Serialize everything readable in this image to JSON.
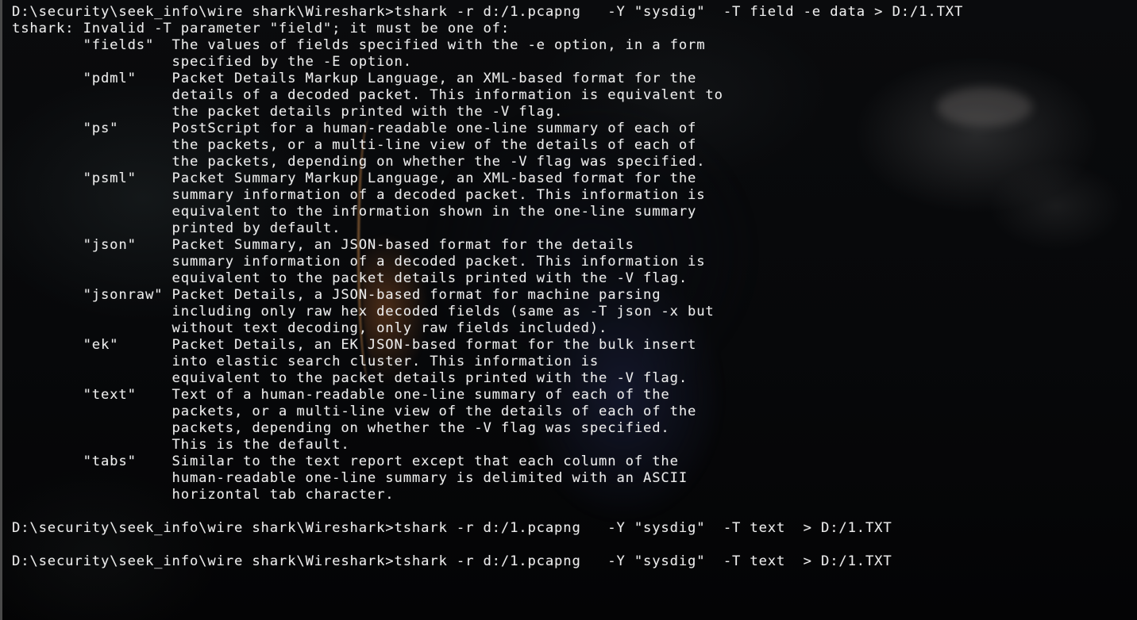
{
  "terminal": {
    "lines": [
      "D:\\security\\seek_info\\wire shark\\Wireshark>tshark -r d:/1.pcapng   -Y \"sysdig\"  -T field -e data > D:/1.TXT",
      "tshark: Invalid -T parameter \"field\"; it must be one of:",
      "        \"fields\"  The values of fields specified with the -e option, in a form",
      "                  specified by the -E option.",
      "        \"pdml\"    Packet Details Markup Language, an XML-based format for the",
      "                  details of a decoded packet. This information is equivalent to",
      "                  the packet details printed with the -V flag.",
      "        \"ps\"      PostScript for a human-readable one-line summary of each of",
      "                  the packets, or a multi-line view of the details of each of",
      "                  the packets, depending on whether the -V flag was specified.",
      "        \"psml\"    Packet Summary Markup Language, an XML-based format for the",
      "                  summary information of a decoded packet. This information is",
      "                  equivalent to the information shown in the one-line summary",
      "                  printed by default.",
      "        \"json\"    Packet Summary, an JSON-based format for the details",
      "                  summary information of a decoded packet. This information is",
      "                  equivalent to the packet details printed with the -V flag.",
      "        \"jsonraw\" Packet Details, a JSON-based format for machine parsing",
      "                  including only raw hex decoded fields (same as -T json -x but",
      "                  without text decoding, only raw fields included).",
      "        \"ek\"      Packet Details, an EK JSON-based format for the bulk insert",
      "                  into elastic search cluster. This information is",
      "                  equivalent to the packet details printed with the -V flag.",
      "        \"text\"    Text of a human-readable one-line summary of each of the",
      "                  packets, or a multi-line view of the details of each of the",
      "                  packets, depending on whether the -V flag was specified.",
      "                  This is the default.",
      "        \"tabs\"    Similar to the text report except that each column of the",
      "                  human-readable one-line summary is delimited with an ASCII",
      "                  horizontal tab character.",
      "",
      "D:\\security\\seek_info\\wire shark\\Wireshark>tshark -r d:/1.pcapng   -Y \"sysdig\"  -T text  > D:/1.TXT",
      "",
      "D:\\security\\seek_info\\wire shark\\Wireshark>tshark -r d:/1.pcapng   -Y \"sysdig\"  -T text  > D:/1.TXT"
    ]
  }
}
